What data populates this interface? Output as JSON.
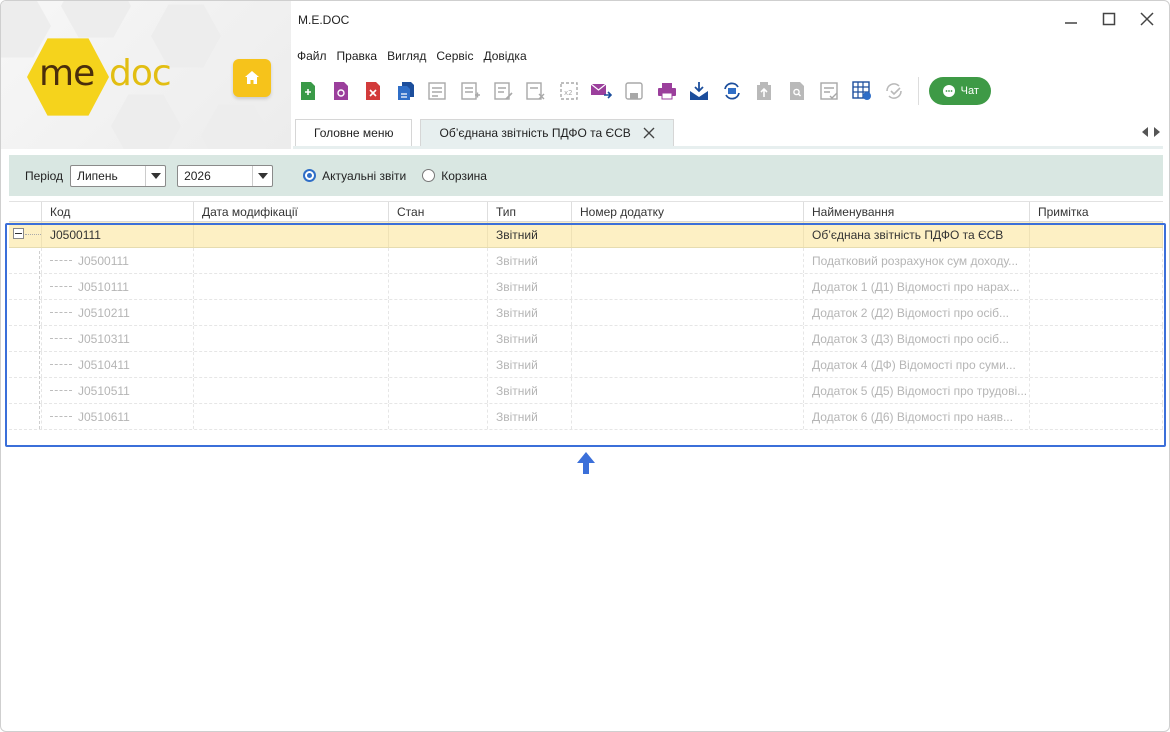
{
  "app": {
    "title": "M.E.DOC",
    "logo_me": "me",
    "logo_doc": "doc"
  },
  "menu": [
    "Файл",
    "Правка",
    "Вигляд",
    "Сервіс",
    "Довідка"
  ],
  "toolbar": {
    "icons": [
      "new-doc-icon",
      "view-doc-icon",
      "delete-doc-icon",
      "copy-doc-icon",
      "edit-list-icon",
      "add-list-icon",
      "edit-doc-icon",
      "remove-doc-icon",
      "x2-icon",
      "send-mail-icon",
      "save-icon",
      "print-icon",
      "receive-icon",
      "sync-icon",
      "upload-icon",
      "search-doc-icon",
      "check-list-icon",
      "table-refresh-icon",
      "check-circle-icon"
    ],
    "chat_label": "Чат"
  },
  "tabs": [
    {
      "label": "Головне меню",
      "active": false
    },
    {
      "label": "Об’єднана звітність ПДФО та ЄСВ",
      "active": true
    }
  ],
  "filter": {
    "period_label": "Період",
    "month": "Липень",
    "year": "2026",
    "radio_current": "Актуальні звіти",
    "radio_trash": "Корзина",
    "selected": "current"
  },
  "table": {
    "columns": [
      "Код",
      "Дата модифікації",
      "Стан",
      "Тип",
      "Номер додатку",
      "Найменування",
      "Примітка"
    ],
    "parent": {
      "code": "J0500111",
      "date": "",
      "state": "",
      "type": "Звітний",
      "num": "",
      "name": "Об’єднана звітність ПДФО та ЄСВ",
      "note": ""
    },
    "children": [
      {
        "code": "J0500111",
        "type": "Звітний",
        "name": "Податковий розрахунок сум доходу..."
      },
      {
        "code": "J0510111",
        "type": "Звітний",
        "name": "Додаток 1 (Д1) Відомості про нарах..."
      },
      {
        "code": "J0510211",
        "type": "Звітний",
        "name": "Додаток 2 (Д2) Відомості про осіб..."
      },
      {
        "code": "J0510311",
        "type": "Звітний",
        "name": "Додаток 3 (Д3) Відомості про осіб..."
      },
      {
        "code": "J0510411",
        "type": "Звітний",
        "name": "Додаток 4 (ДФ) Відомості про суми..."
      },
      {
        "code": "J0510511",
        "type": "Звітний",
        "name": "Додаток 5 (Д5) Відомості про трудові..."
      },
      {
        "code": "J0510611",
        "type": "Звітний",
        "name": "Додаток 6 (Д6) Відомості про наяв..."
      }
    ]
  },
  "colors": {
    "accent": "#3b6fd9",
    "chat": "#3e9a46",
    "logo_yellow": "#f5d31c",
    "row_highlight": "#fdf0c4",
    "filter_bg": "#d9e7e2"
  }
}
